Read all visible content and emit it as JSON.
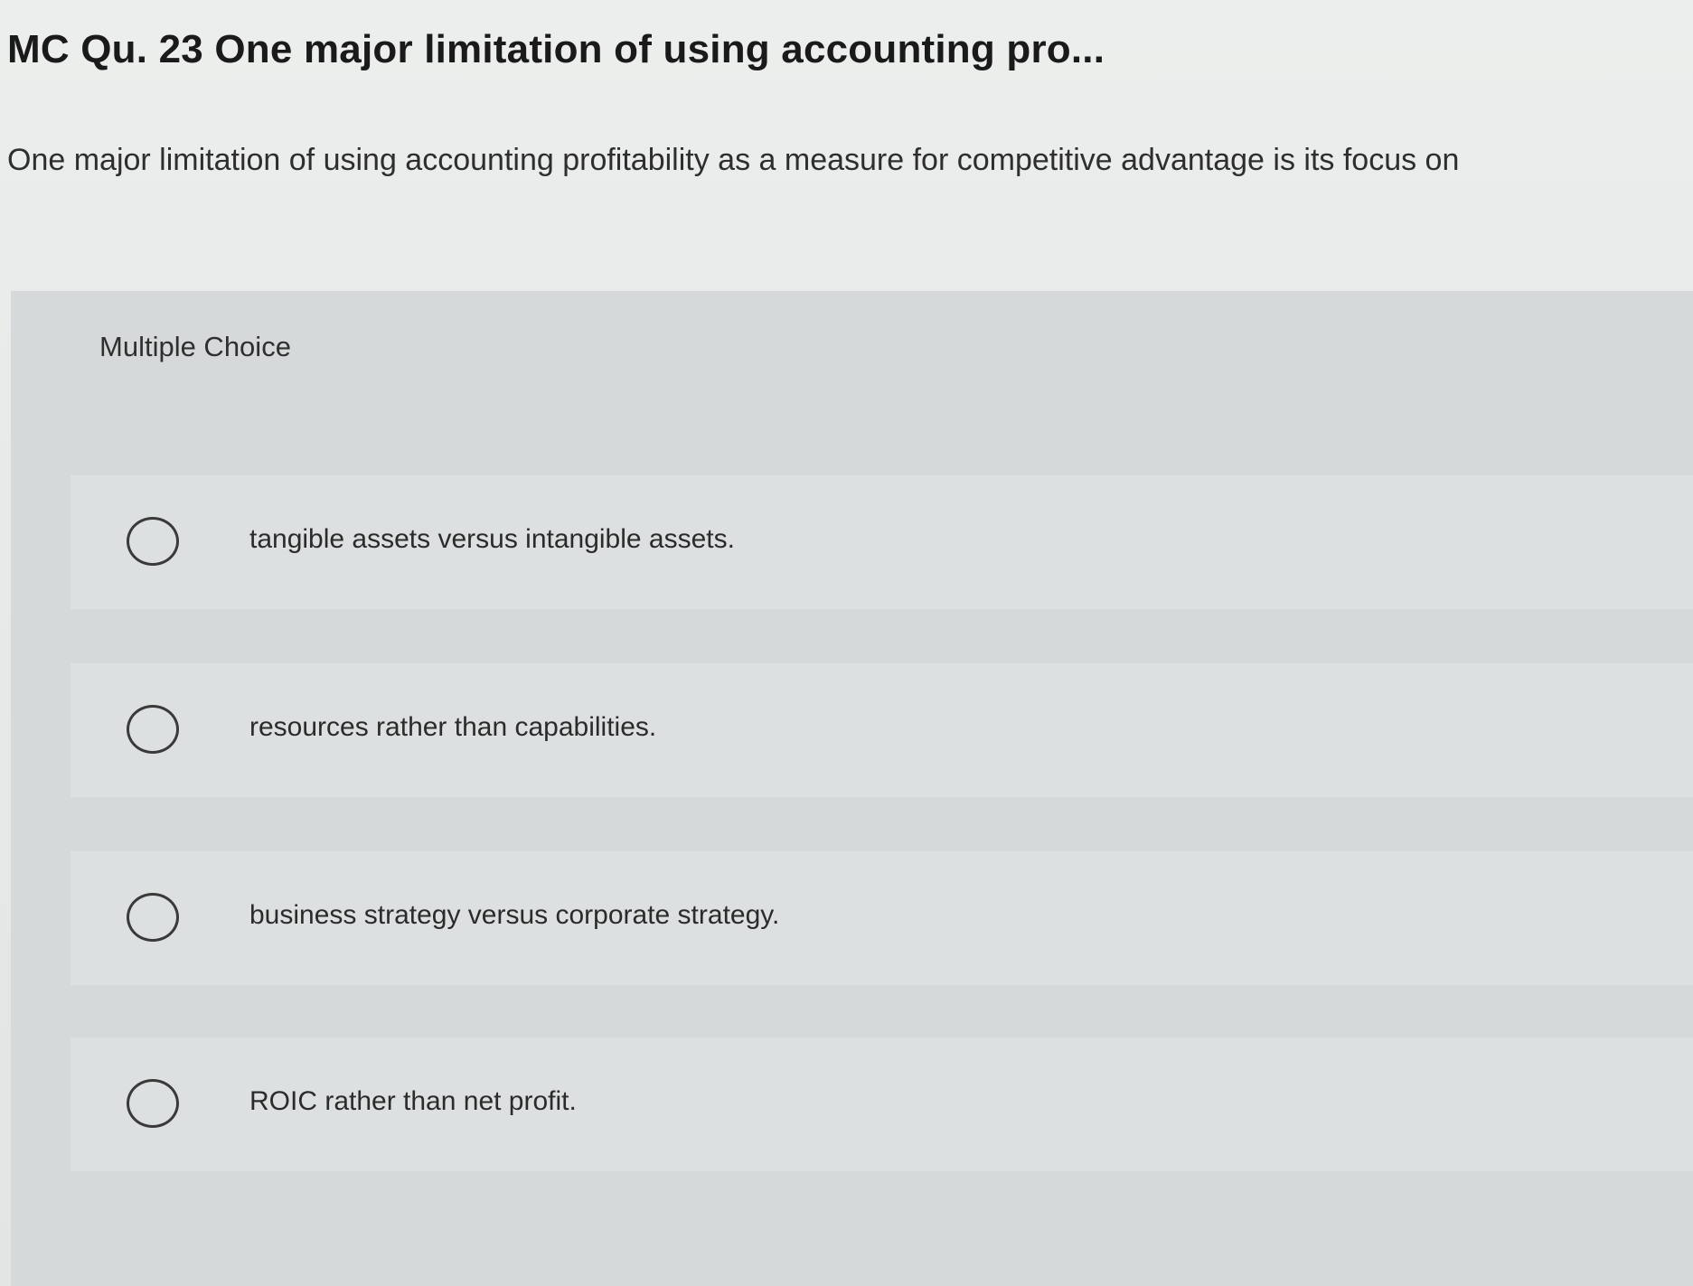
{
  "question": {
    "title": "MC Qu. 23 One major limitation of using accounting pro...",
    "text": "One major limitation of using accounting profitability as a measure for competitive advantage is its focus on"
  },
  "choices": {
    "heading": "Multiple Choice",
    "options": [
      {
        "label": "tangible assets versus intangible assets."
      },
      {
        "label": "resources rather than capabilities."
      },
      {
        "label": "business strategy versus corporate strategy."
      },
      {
        "label": "ROIC rather than net profit."
      }
    ]
  }
}
